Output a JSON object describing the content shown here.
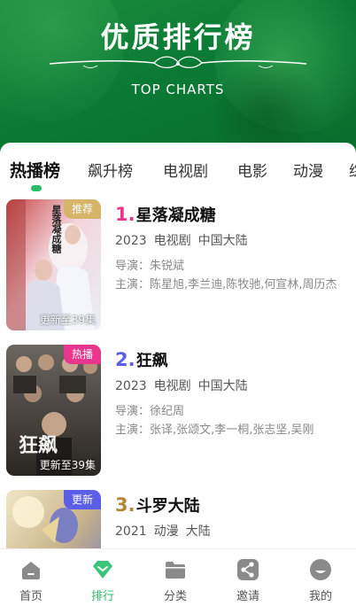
{
  "header": {
    "title": "优质排行榜",
    "subtitle": "TOP CHARTS"
  },
  "tabs": [
    {
      "label": "热播榜",
      "active": true
    },
    {
      "label": "飙升榜"
    },
    {
      "label": "电视剧"
    },
    {
      "label": "电影"
    },
    {
      "label": "动漫"
    },
    {
      "label": "综"
    }
  ],
  "items": [
    {
      "rank": "1.",
      "rank_color": "#e8358d",
      "title": "星落凝成糖",
      "badge": "推荐",
      "badge_color": "#d6b46a",
      "episodes": "更新至39集",
      "year": "2023",
      "type": "电视剧",
      "region": "中国大陆",
      "director": "导演：朱锐斌",
      "cast": "主演：陈星旭,李兰迪,陈牧驰,何宣林,周历杰",
      "poster_text": "星落凝成糖"
    },
    {
      "rank": "2.",
      "rank_color": "#5b5ee6",
      "title": "狂飙",
      "badge": "热播",
      "badge_color": "#e8358d",
      "episodes": "更新至39集",
      "year": "2023",
      "type": "电视剧",
      "region": "中国大陆",
      "director": "导演：徐纪周",
      "cast": "主演：张译,张颂文,李一桐,张志坚,吴刚",
      "poster_text": "狂飙"
    },
    {
      "rank": "3.",
      "rank_color": "#b0863a",
      "title": "斗罗大陆",
      "badge": "更新",
      "badge_color": "#5b5ee6",
      "year": "2021",
      "type": "动漫",
      "region": "大陆"
    }
  ],
  "nav": [
    {
      "label": "首页",
      "icon": "home-icon"
    },
    {
      "label": "排行",
      "icon": "ranking-diamond-icon",
      "active": true
    },
    {
      "label": "分类",
      "icon": "folder-icon"
    },
    {
      "label": "邀请",
      "icon": "share-icon"
    },
    {
      "label": "我的",
      "icon": "profile-icon"
    }
  ],
  "colors": {
    "accent": "#2db96a",
    "header_green": "#0b7a34"
  }
}
